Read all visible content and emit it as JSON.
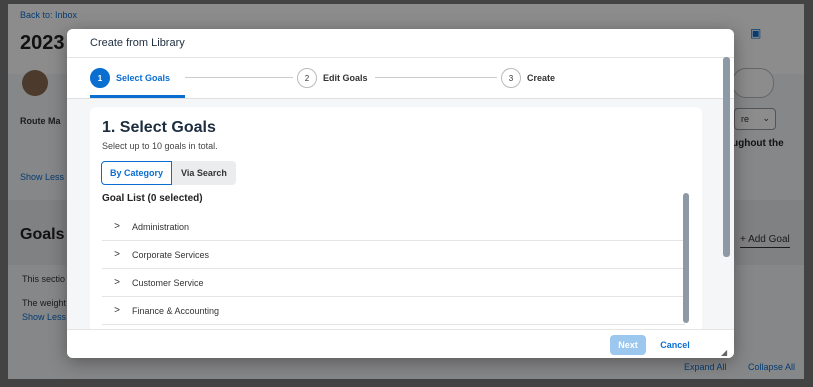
{
  "background": {
    "back_link": "Back to: Inbox",
    "year_fragment": "2023",
    "route_label": "Route Ma",
    "show_less_1": "Show Less",
    "goals_title": "Goals",
    "section_text": "This sectio",
    "weight_text": "The weight",
    "show_less_2": "Show Less",
    "add_goal": "+ Add Goal",
    "throughout_fragment": "ughout the",
    "select_fragment": "re",
    "expand_all": "Expand All",
    "collapse_all": "Collapse All"
  },
  "dialog": {
    "title": "Create from Library",
    "steps": [
      {
        "num": "1",
        "label": "Select Goals",
        "active": true
      },
      {
        "num": "2",
        "label": "Edit Goals",
        "active": false
      },
      {
        "num": "3",
        "label": "Create",
        "active": false
      }
    ],
    "section_title": "1. Select Goals",
    "section_subtitle": "Select up to 10 goals in total.",
    "tabs": {
      "by_category": "By Category",
      "via_search": "Via Search"
    },
    "list_header": "Goal List (0 selected)",
    "goals": [
      "Administration",
      "Corporate Services",
      "Customer Service",
      "Finance & Accounting"
    ],
    "footer": {
      "next": "Next",
      "cancel": "Cancel"
    }
  },
  "colors": {
    "accent": "#0a6ed1",
    "next_disabled": "#9cc7ee"
  }
}
